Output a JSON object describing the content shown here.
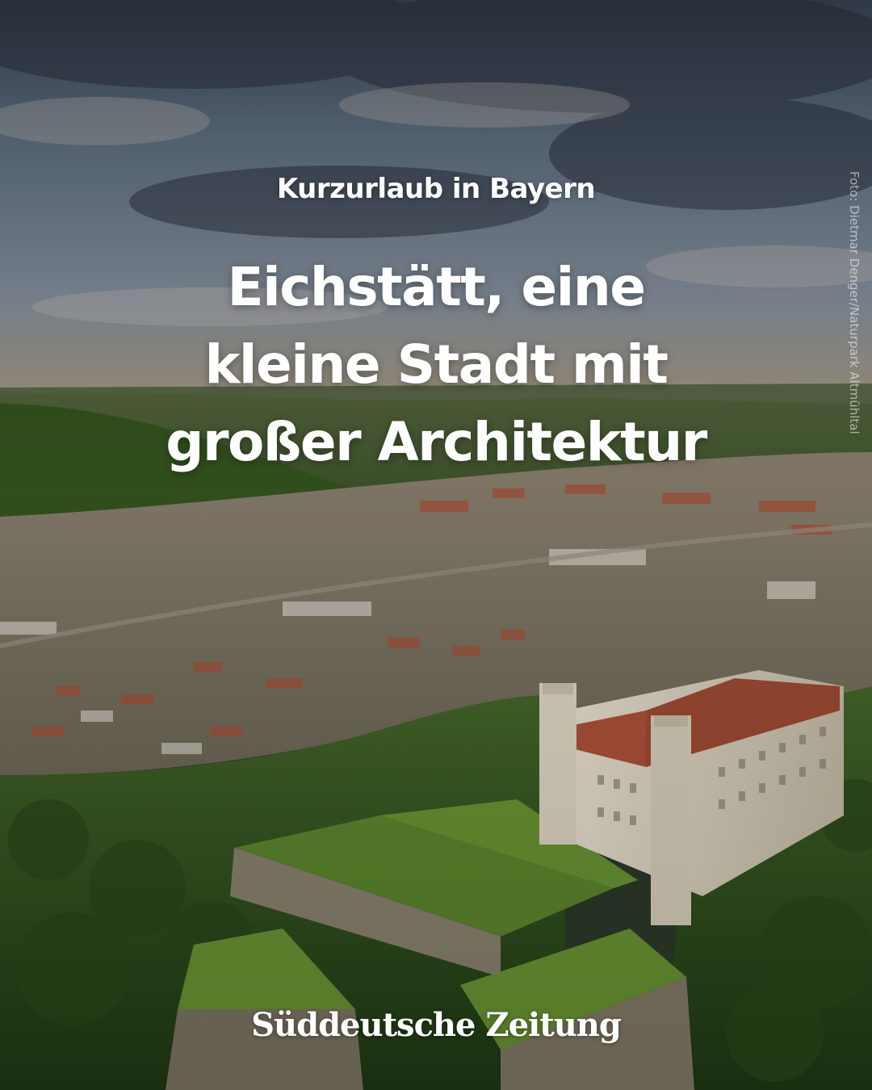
{
  "post": {
    "kicker": "Kurzurlaub in Bayern",
    "headline_lines": [
      "Eichstätt, eine",
      "kleine Stadt mit",
      "großer Architektur"
    ],
    "photo_credit": "Foto: Dietmar Denger/Naturpark Altmühltal",
    "brand_logo": "Süddeutsche Zeitung"
  },
  "colors": {
    "text": "#ffffff",
    "sky": "#6b7f96",
    "forest": "#3f5f2a",
    "castle_wall": "#e6ddcb",
    "roof": "#a8533a"
  }
}
